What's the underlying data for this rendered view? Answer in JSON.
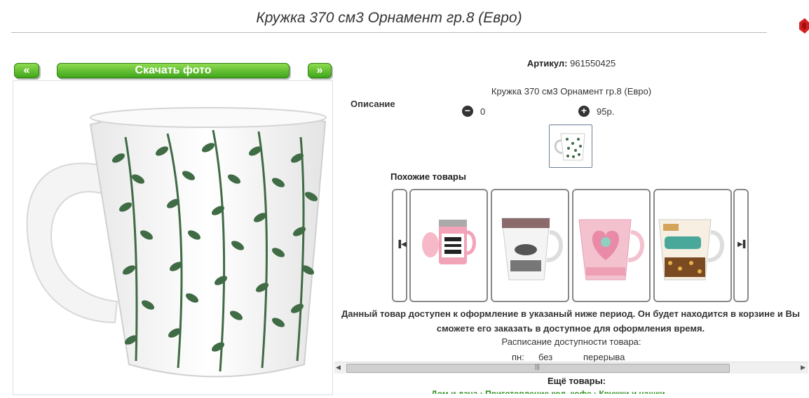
{
  "header": {
    "title": "Кружка 370 см3 Орнамент гр.8 (Евро)"
  },
  "gallery": {
    "prev_label": "«",
    "download_label": "Скачать фото",
    "next_label": "»"
  },
  "product": {
    "article_label": "Артикул:",
    "article_value": "961550425",
    "description_label": "Описание",
    "description_text": "Кружка 370 см3 Орнамент гр.8 (Евро)",
    "quantity": "0",
    "price": "95р."
  },
  "similar": {
    "title": "Похожие товары",
    "items": [
      {
        "name": "self-stirring-mug"
      },
      {
        "name": "fashion-mug"
      },
      {
        "name": "pink-heart-mug"
      },
      {
        "name": "cafe-car-mug"
      }
    ]
  },
  "notice": {
    "text": "Данный товар доступен к оформление в указаный ниже период. Он будет находится в корзине и Вы сможете его заказать в доступное для оформления время.",
    "schedule_title": "Расписание доступности товара:",
    "schedule_day": "пн:",
    "schedule_value_a": "без",
    "schedule_value_b": "перерыва"
  },
  "more": {
    "title": "Ещё товары:",
    "links": "Дом и дача  ›  Приготовление кол. кофе  ›  Кружки и чашки"
  },
  "colors": {
    "accent_green": "#3fa51b",
    "link_green": "#2a8a1a",
    "ornament_green": "#3f6b45"
  }
}
